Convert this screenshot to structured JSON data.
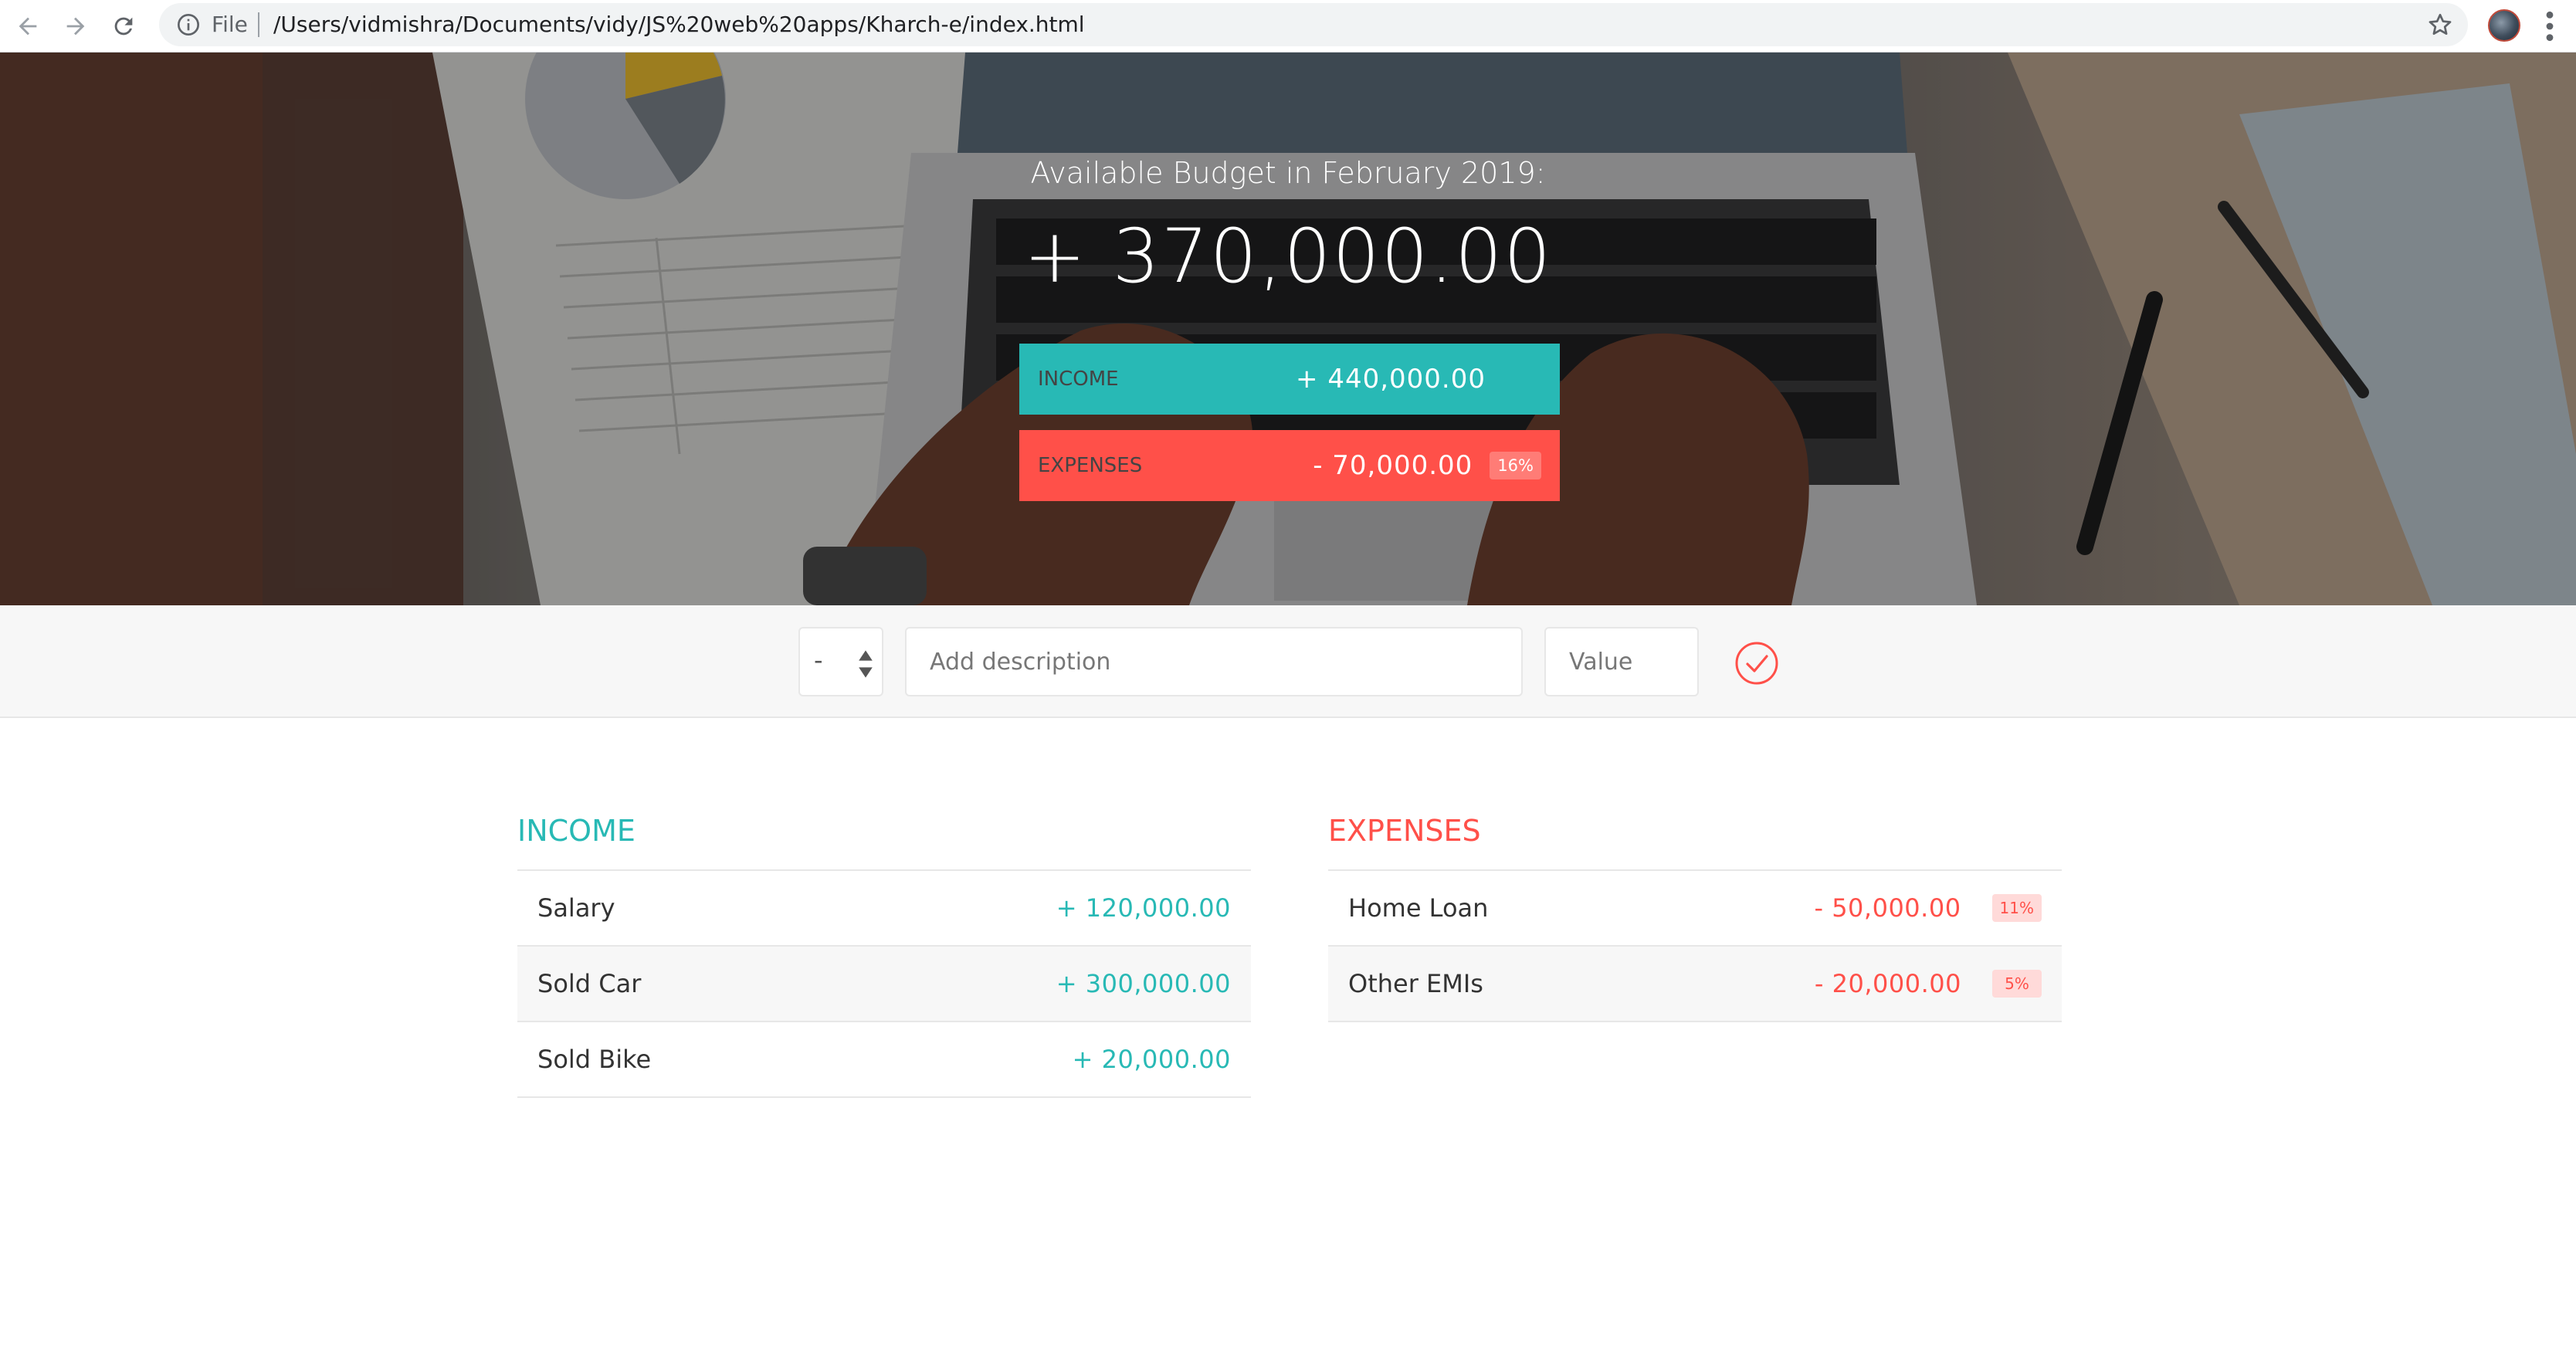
{
  "browser": {
    "scheme_label": "File",
    "url": "/Users/vidmishra/Documents/vidy/JS%20web%20apps/Kharch-e/index.html",
    "icons": [
      "back-arrow-icon",
      "forward-arrow-icon",
      "reload-icon",
      "info-icon",
      "star-icon",
      "profile-avatar",
      "more-menu-icon"
    ]
  },
  "budget": {
    "title": "Available Budget in February 2019:",
    "value": "+ 370,000.00"
  },
  "summary": {
    "income": {
      "label": "INCOME",
      "value": "+ 440,000.00"
    },
    "expenses": {
      "label": "EXPENSES",
      "value": "- 70,000.00",
      "percentage": "16%"
    }
  },
  "add_form": {
    "type_value": "-",
    "description_placeholder": "Add description",
    "value_placeholder": "Value",
    "submit_icon": "check-circle-icon"
  },
  "income": {
    "title": "INCOME",
    "items": [
      {
        "description": "Salary",
        "value": "+ 120,000.00"
      },
      {
        "description": "Sold Car",
        "value": "+ 300,000.00"
      },
      {
        "description": "Sold Bike",
        "value": "+ 20,000.00"
      }
    ]
  },
  "expenses": {
    "title": "EXPENSES",
    "items": [
      {
        "description": "Home Loan",
        "value": "- 50,000.00",
        "percentage": "11%"
      },
      {
        "description": "Other EMIs",
        "value": "- 20,000.00",
        "percentage": "5%"
      }
    ]
  },
  "colors": {
    "income_accent": "#28b9b5",
    "expense_accent": "#ff5049"
  }
}
